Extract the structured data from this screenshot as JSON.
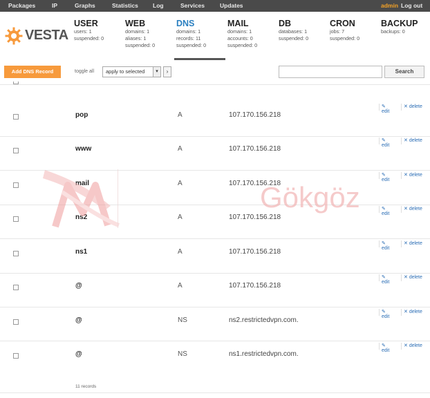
{
  "topbar": {
    "nav": [
      "Packages",
      "IP",
      "Graphs",
      "Statistics",
      "Log",
      "Services",
      "Updates"
    ],
    "user": "admin",
    "logout": "Log out",
    "user_color": "#f4a226"
  },
  "logo": {
    "text": "VESTA",
    "accent": "#f79a3c"
  },
  "stats": [
    {
      "title": "USER",
      "lines": [
        "users: 1",
        "suspended: 0"
      ]
    },
    {
      "title": "WEB",
      "lines": [
        "domains: 1",
        "aliases: 1",
        "suspended: 0"
      ]
    },
    {
      "title": "DNS",
      "lines": [
        "domains: 1",
        "records: 11",
        "suspended: 0"
      ],
      "active": true
    },
    {
      "title": "MAIL",
      "lines": [
        "domains: 1",
        "accounts: 0",
        "suspended: 0"
      ]
    },
    {
      "title": "DB",
      "lines": [
        "databases: 1",
        "suspended: 0"
      ]
    },
    {
      "title": "CRON",
      "lines": [
        "jobs: 7",
        "suspended: 0"
      ]
    },
    {
      "title": "BACKUP",
      "lines": [
        "backups: 0"
      ]
    }
  ],
  "toolbar": {
    "add_label": "Add DNS Record",
    "toggle_label": "toggle all",
    "select_value": "apply to selected",
    "go_label": "›",
    "search_placeholder": "",
    "search_label": "Search"
  },
  "row_actions": {
    "edit": "edit",
    "delete": "delete"
  },
  "records": [
    {
      "name": "pop",
      "type": "A",
      "value": "107.170.156.218"
    },
    {
      "name": "www",
      "type": "A",
      "value": "107.170.156.218"
    },
    {
      "name": "mail",
      "type": "A",
      "value": "107.170.156.218"
    },
    {
      "name": "ns2",
      "type": "A",
      "value": "107.170.156.218"
    },
    {
      "name": "ns1",
      "type": "A",
      "value": "107.170.156.218"
    },
    {
      "name": "@",
      "type": "A",
      "value": "107.170.156.218"
    },
    {
      "name": "@",
      "type": "NS",
      "value": "ns2.restrictedvpn.com."
    },
    {
      "name": "@",
      "type": "NS",
      "value": "ns1.restrictedvpn.com."
    }
  ],
  "footer": {
    "count": "11 records"
  },
  "watermark": {
    "text": "Gökgöz"
  }
}
